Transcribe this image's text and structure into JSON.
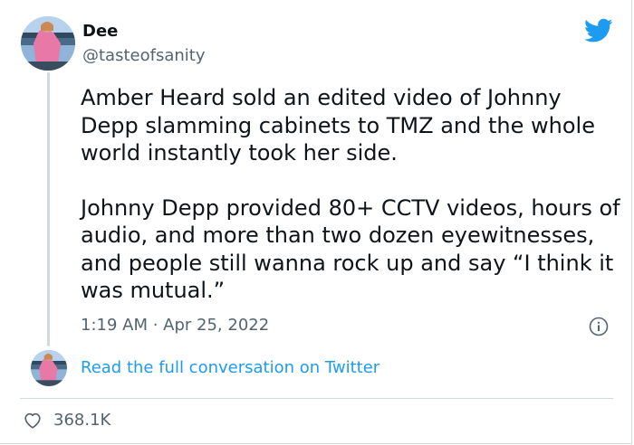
{
  "user": {
    "display_name": "Dee",
    "handle": "@tasteofsanity",
    "avatar_icon": "profile-photo-woman-pink-dress"
  },
  "tweet": {
    "paragraphs": [
      "Amber Heard sold an edited video of Johnny Depp slamming cabinets to TMZ and the whole world instantly took her side.",
      "Johnny Depp provided 80+ CCTV videos, hours of audio, and more than two dozen eyewitnesses, and people still wanna rock up and say “I think it was mutual.”"
    ],
    "timestamp": "1:19 AM · Apr 25, 2022"
  },
  "footer": {
    "read_link": "Read the full conversation on Twitter",
    "like_count": "368.1K"
  },
  "icons": {
    "brand": "twitter-bird-icon",
    "info": "info-icon",
    "like": "heart-icon"
  },
  "colors": {
    "brand_blue": "#1d9bf0",
    "text_primary": "#0f1419",
    "text_secondary": "#536471",
    "border": "#cfd9de"
  }
}
